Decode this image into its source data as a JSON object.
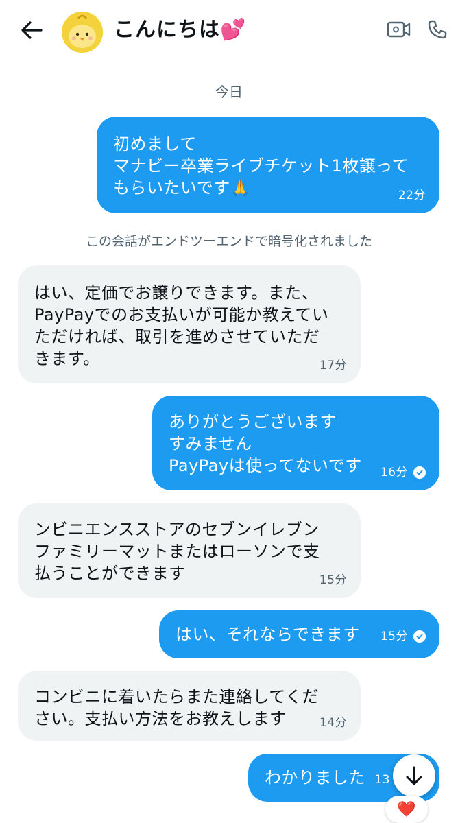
{
  "header": {
    "title": "こんにちは💕",
    "back_icon": "arrow-left-icon",
    "video_icon": "video-call-icon",
    "phone_icon": "phone-icon"
  },
  "date_separator": "今日",
  "encryption_notice": "この会話がエンドツーエンドで暗号化されました",
  "messages": [
    {
      "direction": "out",
      "text": "初めまして\nマナビー卒業ライブチケット1枚譲って\nもらいたいです🙏",
      "time": "22分",
      "read": false
    },
    {
      "direction": "in",
      "text": "はい、定価でお譲りできます。また、\nPayPayでのお支払いが可能か教えてい\nただければ、取引を進めさせていただ\nきます。",
      "time": "17分"
    },
    {
      "direction": "out",
      "text": "ありがとうございます\nすみません\nPayPayは使ってないです",
      "time": "16分",
      "read": true
    },
    {
      "direction": "in",
      "text": "ンビニエンスストアのセブンイレブン\nファミリーマットまたはローソンで支\n払うことができます",
      "time": "15分"
    },
    {
      "direction": "out",
      "text": "はい、それならできます",
      "time": "15分",
      "read": true
    },
    {
      "direction": "in",
      "text": "コンビニに着いたらまた連絡してくだ\nさい。支払い方法をお教えします",
      "time": "14分"
    },
    {
      "direction": "out",
      "text": "わかりました",
      "time": "13",
      "read": false
    }
  ],
  "reaction": "❤️",
  "colors": {
    "outgoing_bubble": "#1d9bf0",
    "incoming_bubble": "#eff3f4",
    "secondary_text": "#536471"
  }
}
